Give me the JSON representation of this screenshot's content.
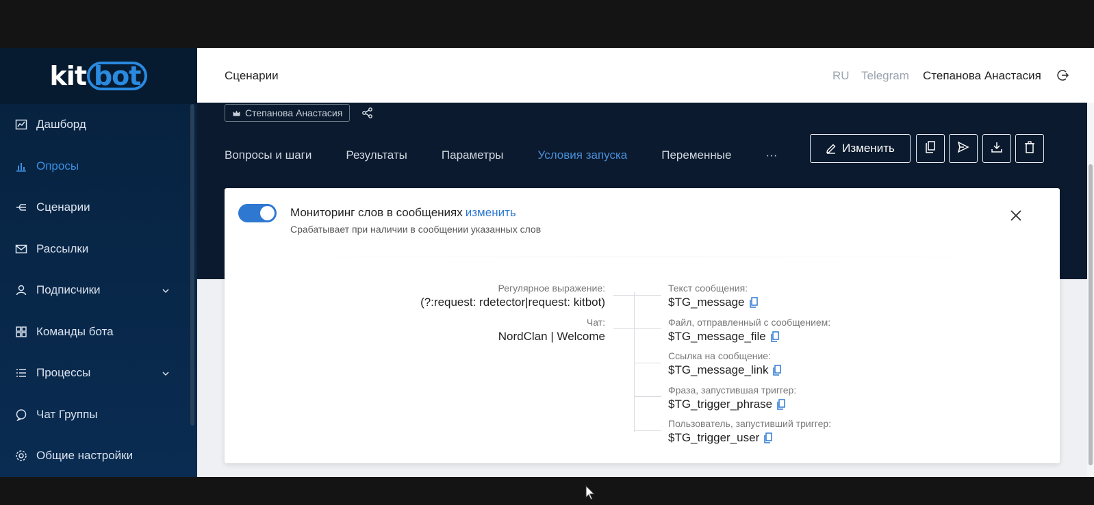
{
  "app": {
    "logo_main": "kit",
    "logo_accent": "bot"
  },
  "sidebar": {
    "items": [
      {
        "label": "Дашборд",
        "icon": "chart-icon"
      },
      {
        "label": "Опросы",
        "icon": "bar-chart-icon",
        "active": true
      },
      {
        "label": "Сценарии",
        "icon": "branch-icon"
      },
      {
        "label": "Рассылки",
        "icon": "mail-icon"
      },
      {
        "label": "Подписчики",
        "icon": "user-icon",
        "has_submenu": true
      },
      {
        "label": "Команды бота",
        "icon": "grid-icon"
      },
      {
        "label": "Процессы",
        "icon": "list-icon",
        "has_submenu": true
      },
      {
        "label": "Чат Группы",
        "icon": "chat-icon"
      },
      {
        "label": "Общие настройки",
        "icon": "gear-icon"
      }
    ]
  },
  "header": {
    "title": "Сценарии",
    "lang": "RU",
    "messenger": "Telegram",
    "user": "Степанова Анастасия"
  },
  "toolbar": {
    "owner": "Степанова Анастасия",
    "tabs": [
      "Вопросы и шаги",
      "Результаты",
      "Параметры",
      "Условия запуска",
      "Переменные",
      "···"
    ],
    "active_tab_index": 3,
    "edit_label": "Изменить"
  },
  "card": {
    "title": "Мониторинг слов в сообщениях",
    "title_link": "изменить",
    "subtitle": "Срабатывает при наличии в сообщении указанных слов",
    "toggle_on": true,
    "params": [
      {
        "label": "Регулярное выражение:",
        "value": "(?:request: rdetector|request: kitbot)"
      },
      {
        "label": "Чат:",
        "value": "NordClan | Welcome"
      }
    ],
    "variables": [
      {
        "label": "Текст сообщения:",
        "value": "$TG_message"
      },
      {
        "label": "Файл, отправленный с сообщением:",
        "value": "$TG_message_file"
      },
      {
        "label": "Ссылка на сообщение:",
        "value": "$TG_message_link"
      },
      {
        "label": "Фраза, запустившая триггер:",
        "value": "$TG_trigger_phrase"
      },
      {
        "label": "Пользователь, запустивший триггер:",
        "value": "$TG_trigger_user"
      }
    ]
  },
  "colors": {
    "accent": "#2e78d2",
    "sidebar_bg": "#06213d",
    "dark_band": "#0b1a2e"
  }
}
